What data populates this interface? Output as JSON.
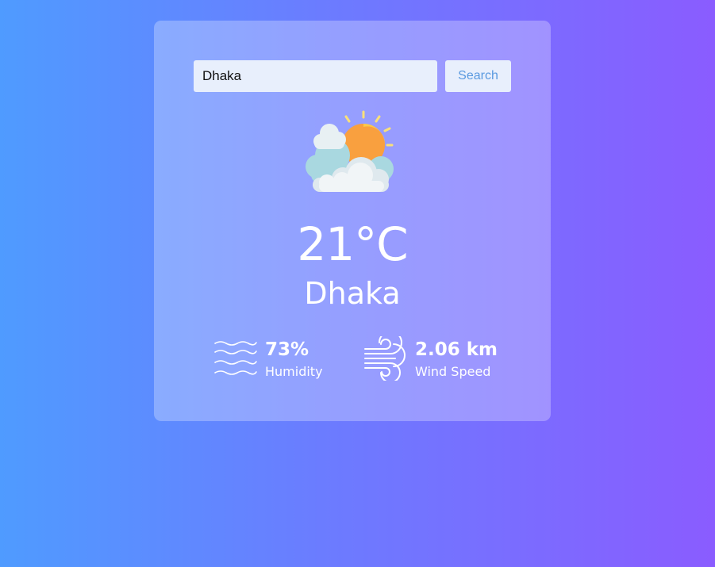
{
  "search": {
    "value": "Dhaka",
    "button_label": "Search"
  },
  "weather": {
    "icon": "partly-cloudy-sun-icon",
    "temperature": "21°C",
    "city": "Dhaka"
  },
  "details": {
    "humidity_value": "73%",
    "humidity_label": "Humidity",
    "humidity_icon": "humidity-waves-icon",
    "wind_value": "2.06 km",
    "wind_label": "Wind Speed",
    "wind_icon": "wind-icon"
  },
  "colors": {
    "gradient_start": "#4f9bff",
    "gradient_end": "#8a5cff",
    "input_bg": "#e8effc",
    "button_text": "#5a9ae0",
    "text": "#ffffff"
  }
}
